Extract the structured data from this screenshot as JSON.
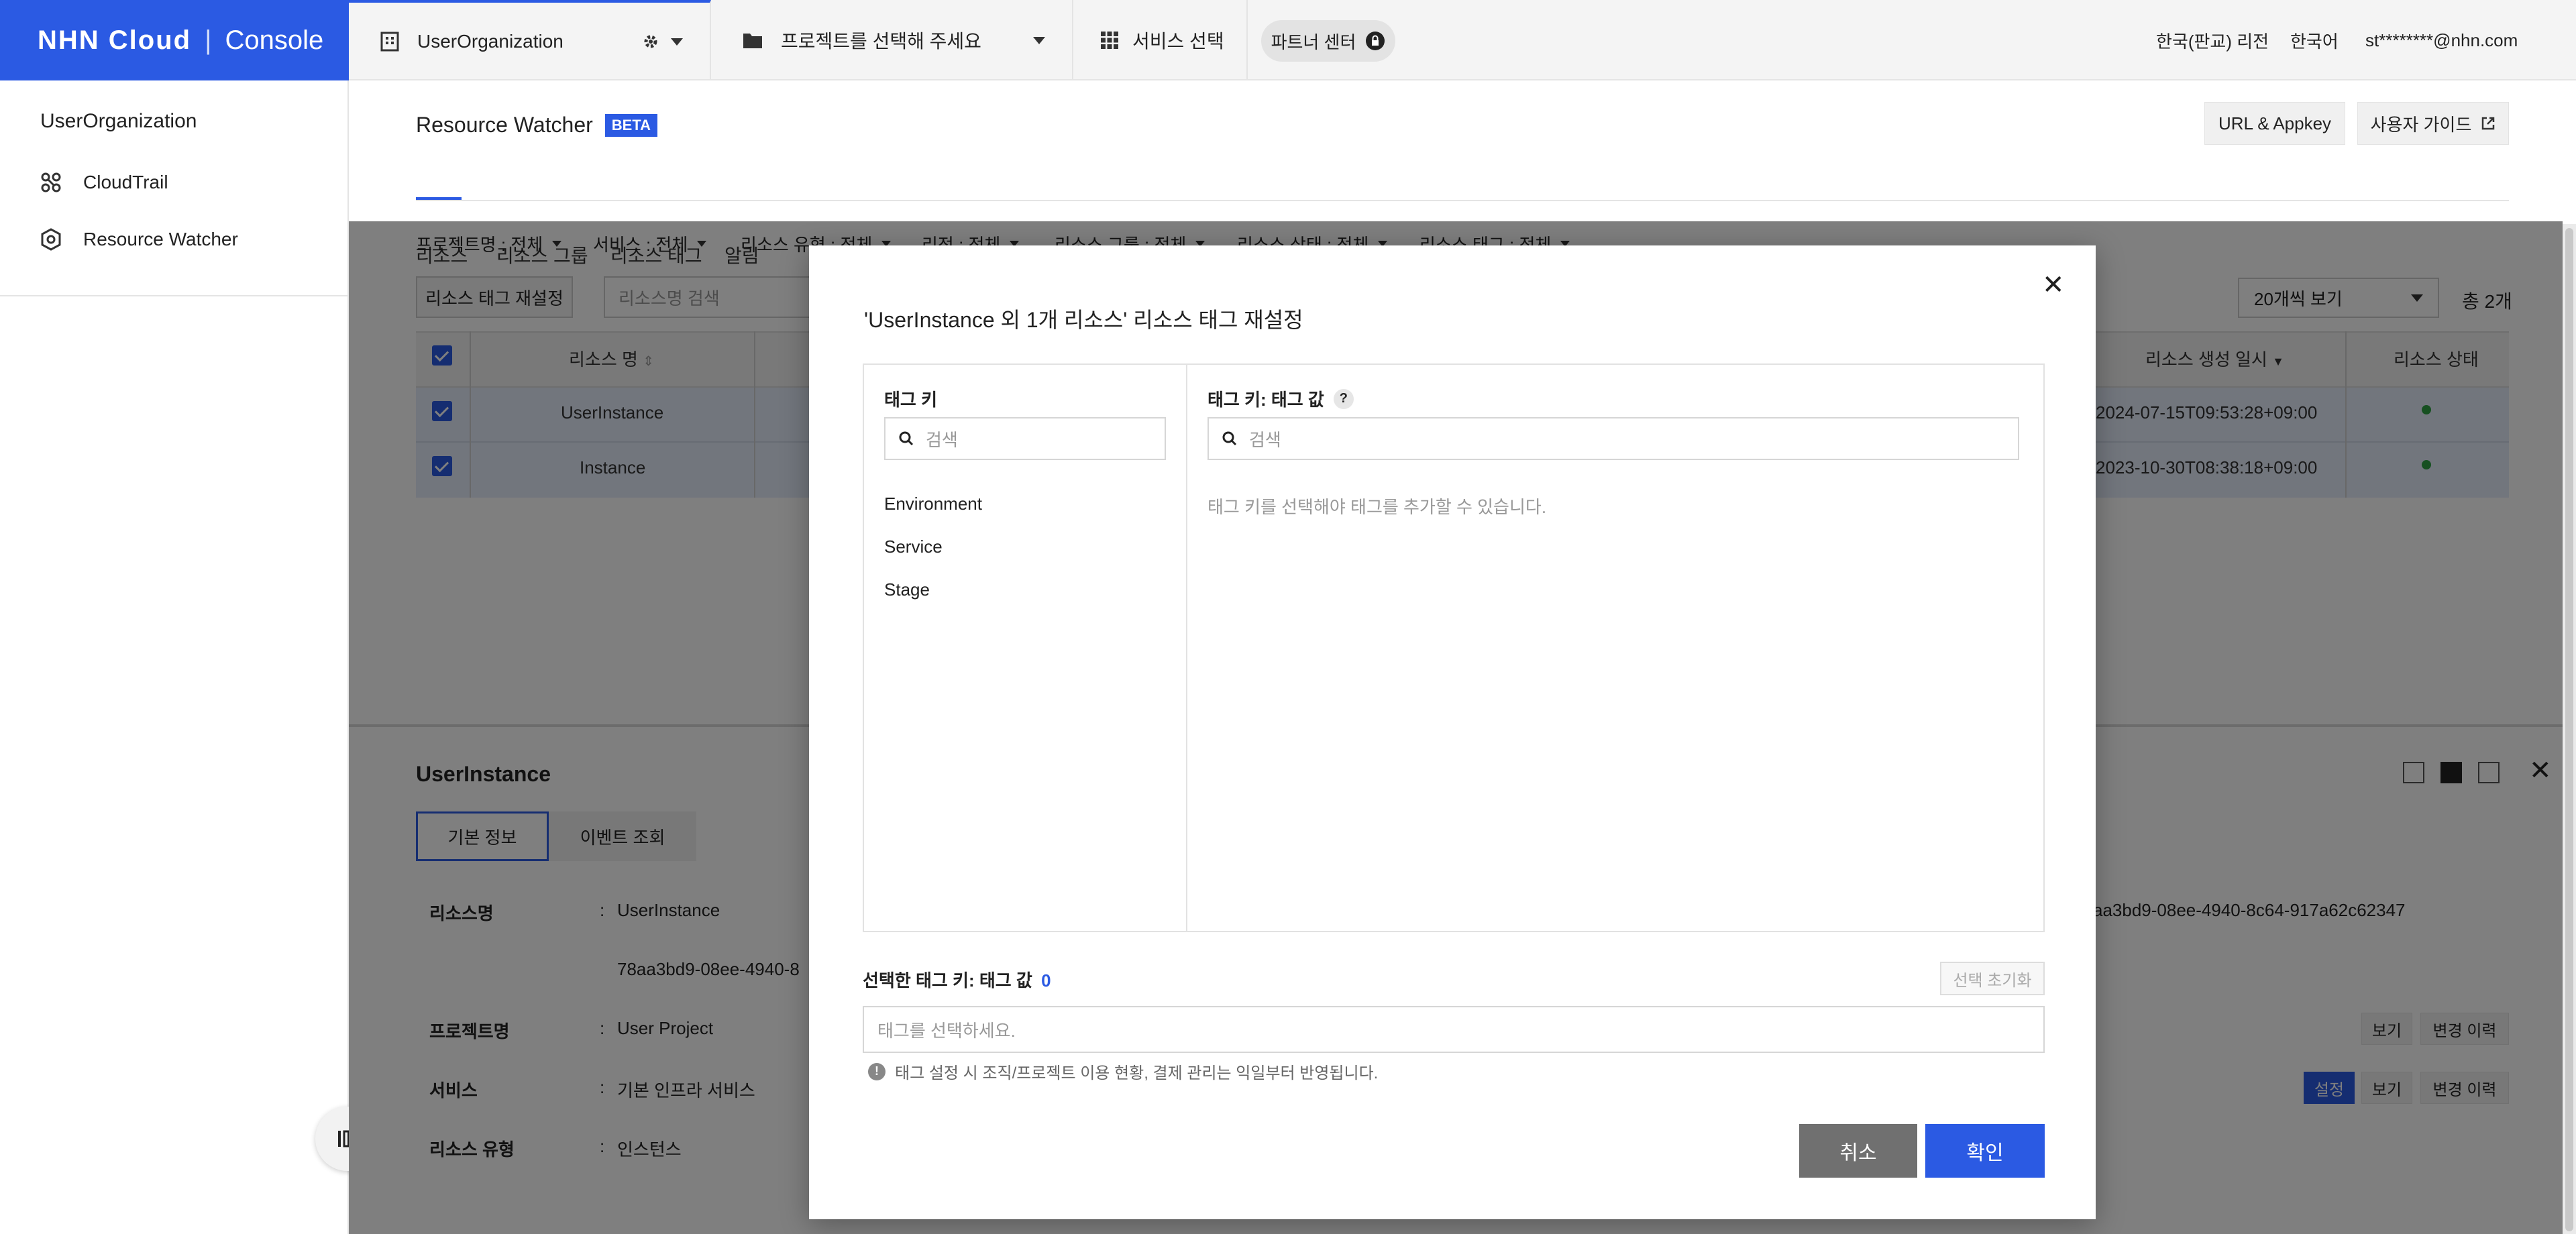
{
  "brand": {
    "logo": "NHN Cloud",
    "product": "Console"
  },
  "topbar": {
    "org": "UserOrganization",
    "project_placeholder": "프로젝트를 선택해 주세요",
    "service_select": "서비스 선택",
    "partner_center": "파트너 센터",
    "region": "한국(판교) 리전",
    "language": "한국어",
    "user": "st********@nhn.com"
  },
  "sidebar": {
    "org_title": "UserOrganization",
    "items": [
      {
        "label": "CloudTrail",
        "icon": "cloudtrail-icon"
      },
      {
        "label": "Resource Watcher",
        "icon": "resource-watcher-icon"
      }
    ]
  },
  "page": {
    "title": "Resource Watcher",
    "badge": "BETA",
    "url_appkey": "URL & Appkey",
    "user_guide": "사용자 가이드",
    "tabs": [
      "리소스",
      "리소스 그룹",
      "리소스 태그",
      "알림"
    ],
    "active_tab": 0
  },
  "filters": [
    "프로젝트명 : 전체",
    "서비스 : 전체",
    "리소스 유형 : 전체",
    "리전 : 전체",
    "리소스 그룹 : 전체",
    "리소스 상태 : 전체",
    "리소스 태그 : 전체"
  ],
  "toolbar": {
    "reset_tag_button": "리소스 태그 재설정",
    "search_placeholder": "리소스명 검색",
    "page_size": "20개씩 보기",
    "total": "총 2개"
  },
  "table": {
    "headers": {
      "name": "리소스 명",
      "created": "리소스 생성 일시",
      "status": "리소스 상태"
    },
    "rows": [
      {
        "name": "UserInstance",
        "created": "2024-07-15T09:53:28+09:00"
      },
      {
        "name": "Instance",
        "created": "2023-10-30T08:38:18+09:00"
      }
    ]
  },
  "detail": {
    "title": "UserInstance",
    "tabs": [
      "기본 정보",
      "이벤트 조회"
    ],
    "rows": [
      {
        "label": "리소스명",
        "value": "UserInstance"
      },
      {
        "label": "",
        "value": "78aa3bd9-08ee-4940-8"
      },
      {
        "label": "프로젝트명",
        "value": "User Project"
      },
      {
        "label": "서비스",
        "value": "기본 인프라 서비스"
      },
      {
        "label": "리소스 유형",
        "value": "인스턴스"
      }
    ],
    "right_id": "aa3bd9-08ee-4940-8c64-917a62c62347",
    "btn_view": "보기",
    "btn_history": "변경 이력",
    "btn_setting": "설정"
  },
  "modal": {
    "title": "'UserInstance 외 1개 리소스' 리소스 태그 재설정",
    "tag_key_label": "태그 키",
    "tag_value_label": "태그 키: 태그 값",
    "search_placeholder": "검색",
    "tag_keys": [
      "Environment",
      "Service",
      "Stage"
    ],
    "empty_hint": "태그 키를 선택해야 태그를 추가할 수 있습니다.",
    "selected_label": "선택한 태그 키: 태그 값",
    "selected_count": "0",
    "reset_selection": "선택 초기화",
    "selected_placeholder": "태그를 선택하세요.",
    "notice": "태그 설정 시 조직/프로젝트 이용 현황, 결제 관리는 익일부터 반영됩니다.",
    "cancel": "취소",
    "confirm": "확인"
  },
  "colors": {
    "accent": "#2b5ae3",
    "status_ok": "#2ea043",
    "cancel_btn": "#707070"
  }
}
